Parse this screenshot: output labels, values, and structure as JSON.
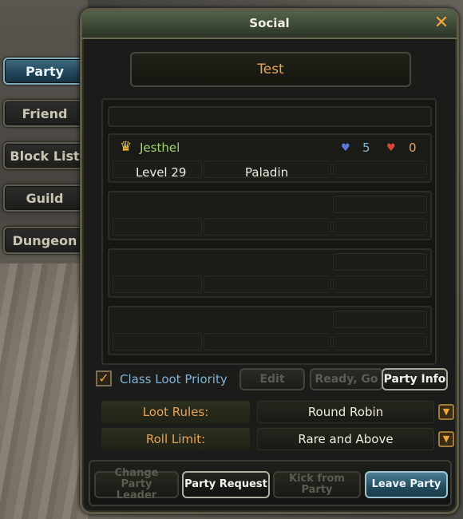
{
  "window": {
    "title": "Social"
  },
  "tabs": [
    {
      "label": "Party",
      "active": true
    },
    {
      "label": "Friend"
    },
    {
      "label": "Block List"
    },
    {
      "label": "Guild"
    },
    {
      "label": "Dungeon"
    }
  ],
  "party": {
    "name": "Test",
    "members": [
      {
        "name": "Jesthel",
        "level": "Level 29",
        "class": "Paladin",
        "blue_value": "5",
        "red_value": "0",
        "leader": true
      }
    ]
  },
  "loot": {
    "class_loot_priority_label": "Class Loot Priority",
    "class_loot_priority_checked": true,
    "edit_label": "Edit",
    "ready_label": "Ready, Go",
    "party_info_label": "Party Info",
    "loot_rules_label": "Loot Rules:",
    "loot_rules_value": "Round Robin",
    "roll_limit_label": "Roll Limit:",
    "roll_limit_value": "Rare and Above"
  },
  "actions": {
    "change_leader": "Change Party Leader",
    "party_request": "Party Request",
    "kick": "Kick from Party",
    "leave": "Leave Party"
  },
  "colors": {
    "accent_orange": "#e8a35a",
    "member_green": "#9ed46a",
    "blue_stat": "#7fb3d2",
    "red_stat": "#e8a35a",
    "active_tab": "#2e5a6f"
  }
}
